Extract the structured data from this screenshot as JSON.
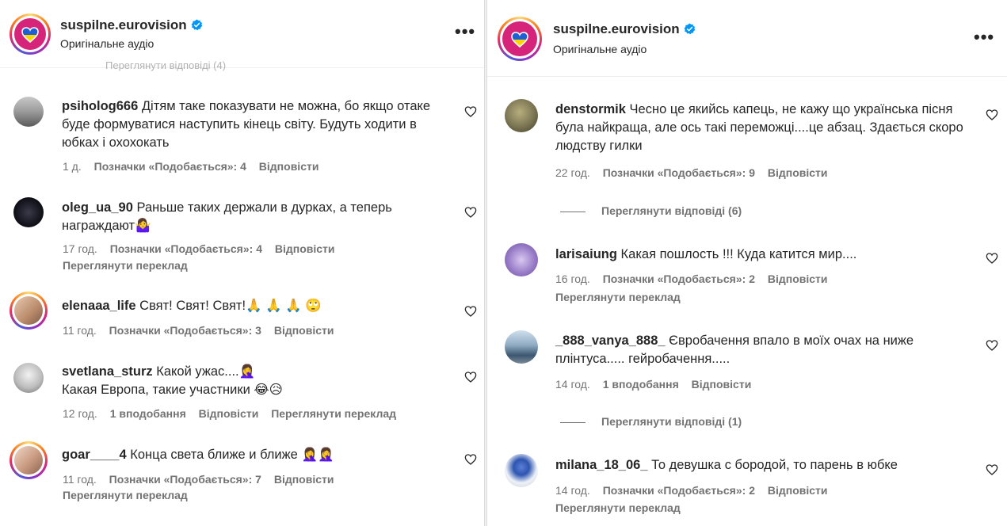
{
  "header": {
    "account": "suspilne.eurovision",
    "subtitle": "Оригінальне аудіо",
    "more": "•••"
  },
  "left": {
    "cutoff": "Переглянути відповіді (4)",
    "comments": [
      {
        "user": "psiholog666",
        "text": "Дітям таке показувати не можна, бо якщо отаке буде формуватися наступить кінець світу. Будуть ходити в юбках і охохокать",
        "time": "1 д.",
        "likes": "Позначки «Подобається»: 4",
        "reply": "Відповісти"
      },
      {
        "user": "oleg_ua_90",
        "text": "Раньше таких держали в дурках, а теперь награждают🤷‍♀️",
        "time": "17 год.",
        "likes": "Позначки «Подобається»: 4",
        "reply": "Відповісти",
        "translate": "Переглянути переклад"
      },
      {
        "user": "elenaaa_life",
        "text": "Свят! Свят! Свят!🙏 🙏 🙏 🙄",
        "time": "11 год.",
        "likes": "Позначки «Подобається»: 3",
        "reply": "Відповісти"
      },
      {
        "user": "svetlana_sturz",
        "text": "Какой ужас....🤦‍♀️",
        "text2": "Какая Европа, такие участники 😂😥",
        "time": "12 год.",
        "likes": "1 вподобання",
        "reply": "Відповісти",
        "translate": "Переглянути переклад"
      },
      {
        "user": "goar____4",
        "text": "Конца света ближе и ближе 🤦‍♀️🤦‍♀️",
        "time": "11 год.",
        "likes": "Позначки «Подобається»: 7",
        "reply": "Відповісти",
        "translate": "Переглянути переклад"
      }
    ]
  },
  "right": {
    "comments": [
      {
        "user": "denstormik",
        "text": "Чесно це якийсь капець, не кажу що українська пісня була найкраща, але ось такі переможці....це абзац. Здається скоро людству гилки",
        "time": "22 год.",
        "likes": "Позначки «Подобається»: 9",
        "reply": "Відповісти",
        "replies": "Переглянути відповіді (6)"
      },
      {
        "user": "larisaiung",
        "text": "Какая пошлость !!! Куда катится мир....",
        "time": "16 год.",
        "likes": "Позначки «Подобається»: 2",
        "reply": "Відповісти",
        "translate": "Переглянути переклад"
      },
      {
        "user": "_888_vanya_888_",
        "text": "Євробачення впало в моїх очах на ниже плінтуса..... гейробачення.....",
        "time": "14 год.",
        "likes": "1 вподобання",
        "reply": "Відповісти",
        "replies": "Переглянути відповіді (1)"
      },
      {
        "user": "milana_18_06_",
        "text": "То девушка с бородой, то парень в юбке",
        "time": "14 год.",
        "likes": "Позначки «Подобається»: 2",
        "reply": "Відповісти",
        "translate": "Переглянути переклад"
      }
    ]
  },
  "colors": {
    "verified": "#0095f6",
    "avatar_pink": "#d6247a",
    "text": "#262626",
    "secondary": "#737373"
  },
  "icons": [
    "heart-outline-icon",
    "verified-badge-icon",
    "more-options-icon",
    "ukraine-heart-icon"
  ]
}
